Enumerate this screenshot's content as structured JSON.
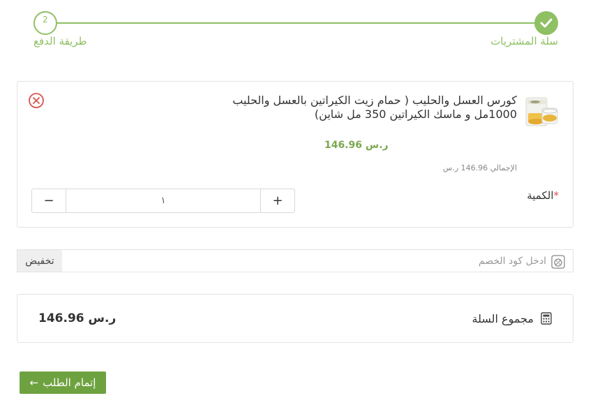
{
  "stepper": {
    "step1": {
      "label": "سلة المشتريات",
      "status": "done"
    },
    "step2": {
      "label": "طريقة الدفع",
      "number": "2"
    }
  },
  "product": {
    "title": "كورس العسل والحليب ( حمام زيت الكيراتين بالعسل والحليب 1000مل و ماسك الكيراتين 350 مل شاين)",
    "price": "146.96 ر.س",
    "total_text": "الإجمالي 146.96 ر.س",
    "quantity_label": "الكمية",
    "required_mark": "*",
    "quantity_value": "١",
    "minus": "−",
    "plus": "+"
  },
  "coupon": {
    "placeholder": "ادخل كود الخصم",
    "apply_label": "تخفيض"
  },
  "cart_total": {
    "label": "مجموع السلة",
    "value": "146.96 ر.س"
  },
  "checkout": {
    "label": "إتمام الطلب",
    "arrow": "←"
  },
  "colors": {
    "accent": "#8fc064",
    "button": "#6ea240",
    "price": "#7aa84f",
    "remove": "#d9534f"
  }
}
